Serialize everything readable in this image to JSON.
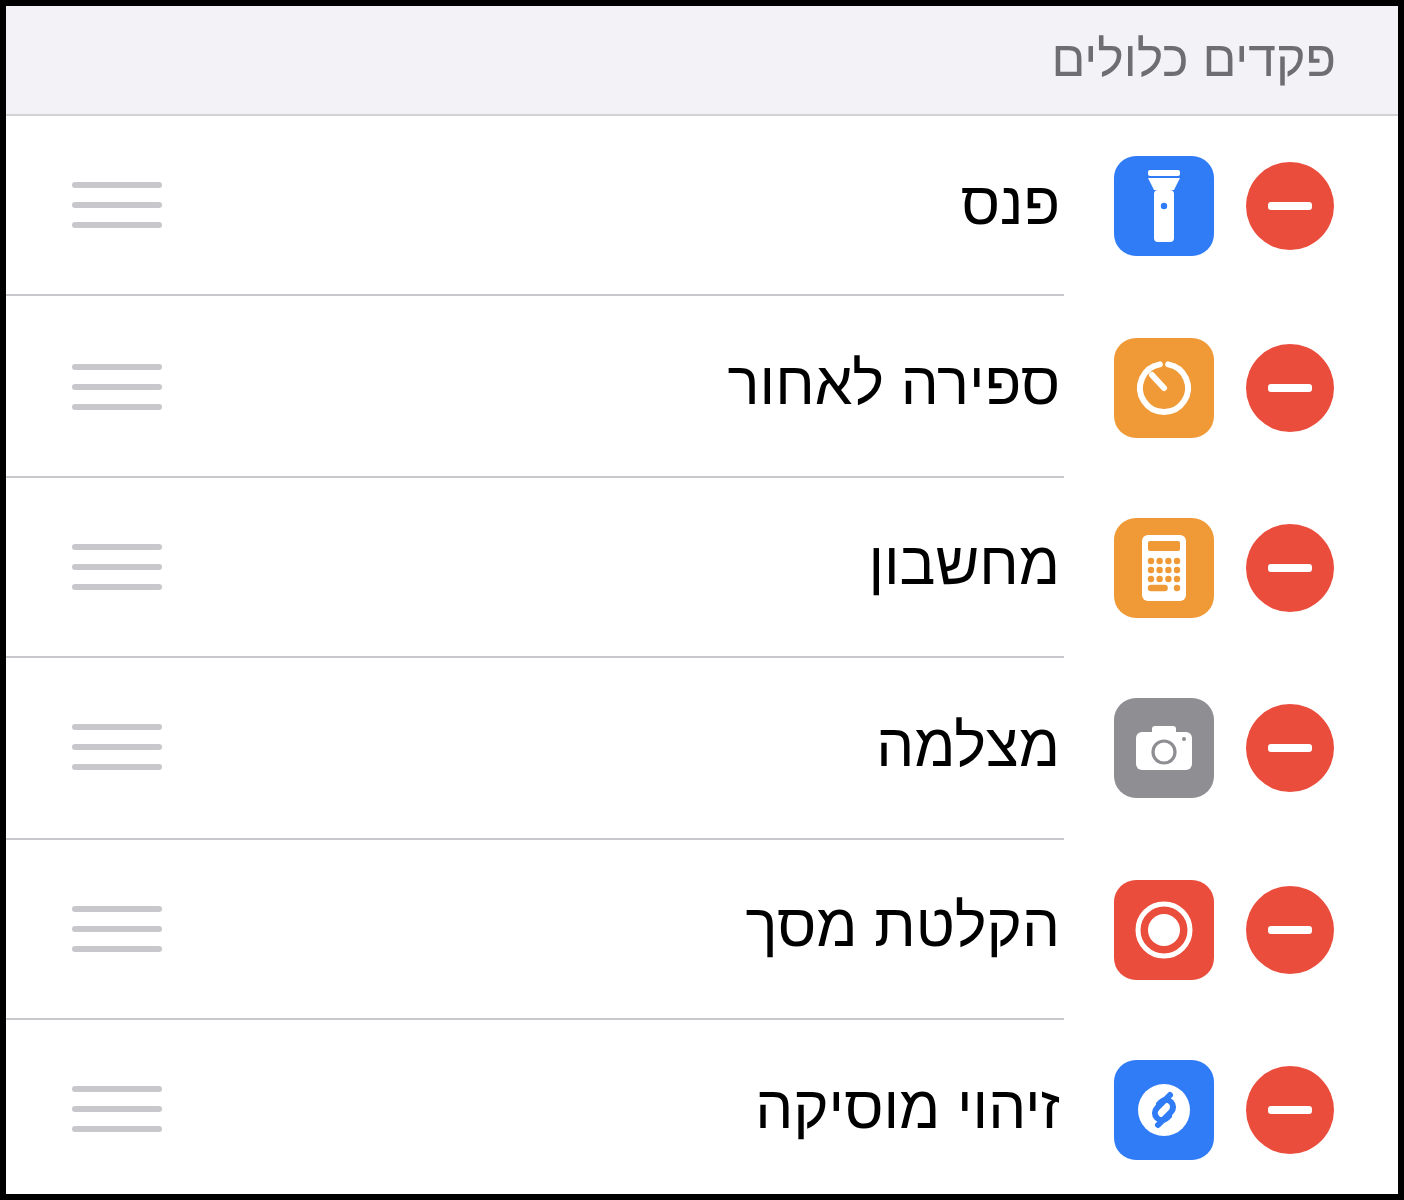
{
  "section": {
    "title": "פקדים כלולים"
  },
  "rows": [
    {
      "label": "פנס",
      "kind": "flashlight",
      "color": "#2f7cf6"
    },
    {
      "label": "ספירה לאחור",
      "kind": "timer",
      "color": "#f09a37"
    },
    {
      "label": "מחשבון",
      "kind": "calculator",
      "color": "#f09a37"
    },
    {
      "label": "מצלמה",
      "kind": "camera",
      "color": "#8e8e93"
    },
    {
      "label": "הקלטת מסך",
      "kind": "record",
      "color": "#eb4d3d"
    },
    {
      "label": "זיהוי מוסיקה",
      "kind": "music",
      "color": "#2f7cf6"
    }
  ]
}
